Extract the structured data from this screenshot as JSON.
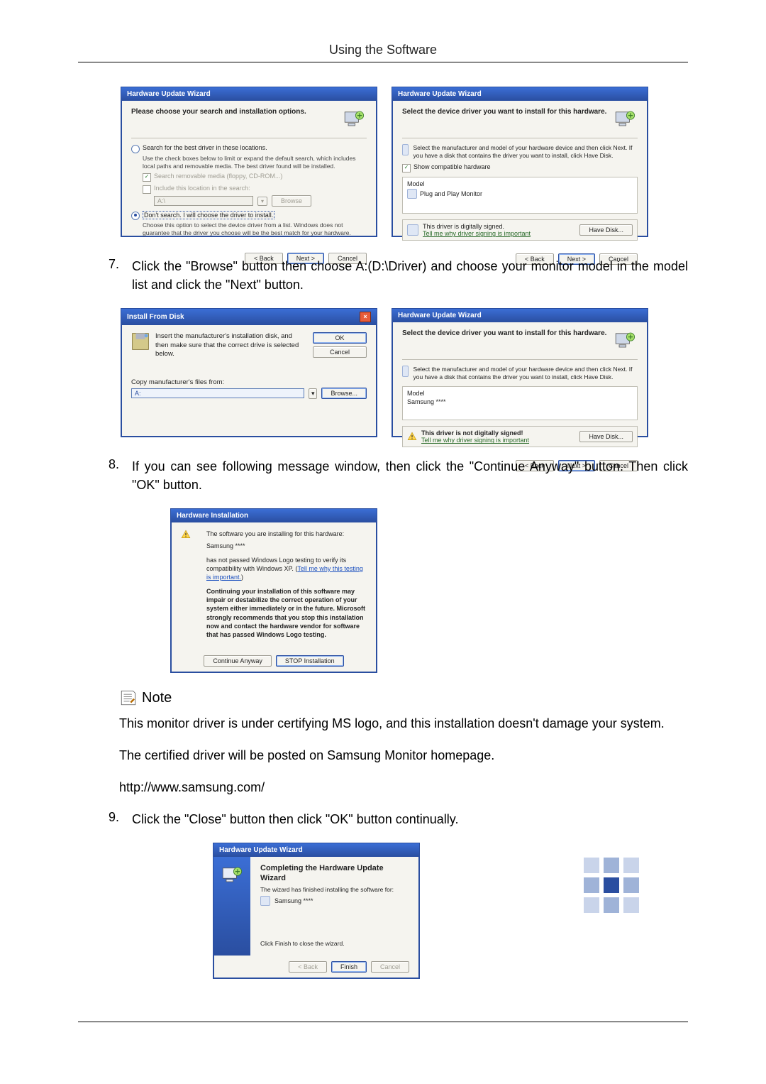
{
  "header": {
    "title": "Using the Software"
  },
  "dlg1": {
    "title": "Hardware Update Wizard",
    "headline": "Please choose your search and installation options.",
    "radio1": "Search for the best driver in these locations.",
    "radio1_sub": "Use the check boxes below to limit or expand the default search, which includes local paths and removable media. The best driver found will be installed.",
    "chk1": "Search removable media (floppy, CD-ROM...)",
    "chk2": "Include this location in the search:",
    "path_value": "A:\\",
    "browse_btn": "Browse",
    "radio2": "Don't search. I will choose the driver to install.",
    "radio2_sub": "Choose this option to select the device driver from a list. Windows does not guarantee that the driver you choose will be the best match for your hardware.",
    "back": "< Back",
    "next": "Next >",
    "cancel": "Cancel"
  },
  "dlg2": {
    "title": "Hardware Update Wizard",
    "headline": "Select the device driver you want to install for this hardware.",
    "instruction": "Select the manufacturer and model of your hardware device and then click Next. If you have a disk that contains the driver you want to install, click Have Disk.",
    "show_compat": "Show compatible hardware",
    "model_label": "Model",
    "model_item": "Plug and Play Monitor",
    "signed": "This driver is digitally signed.",
    "tell_me": "Tell me why driver signing is important",
    "have_disk": "Have Disk...",
    "back": "< Back",
    "next": "Next >",
    "cancel": "Cancel"
  },
  "step7": {
    "num": "7.",
    "text": "Click the \"Browse\" button then choose A:(D:\\Driver) and choose your monitor model in the model list and click the \"Next\" button."
  },
  "dlg3": {
    "title": "Install From Disk",
    "msg": "Insert the manufacturer's installation disk, and then make sure that the correct drive is selected below.",
    "ok": "OK",
    "cancel": "Cancel",
    "copy_label": "Copy manufacturer's files from:",
    "path": "A:",
    "browse": "Browse..."
  },
  "dlg4": {
    "title": "Hardware Update Wizard",
    "headline": "Select the device driver you want to install for this hardware.",
    "instruction": "Select the manufacturer and model of your hardware device and then click Next. If you have a disk that contains the driver you want to install, click Have Disk.",
    "model_label": "Model",
    "model_item": "Samsung ****",
    "signed": "This driver is not digitally signed!",
    "tell_me": "Tell me why driver signing is important",
    "have_disk": "Have Disk...",
    "back": "< Back",
    "next": "Next >",
    "cancel": "Cancel"
  },
  "step8": {
    "num": "8.",
    "text": "If you can see following message window, then click the \"Continue Anyway\" button. Then click \"OK\" button."
  },
  "dlg5": {
    "title": "Hardware Installation",
    "line1": "The software you are installing for this hardware:",
    "line2": "Samsung ****",
    "line3a": "has not passed Windows Logo testing to verify its compatibility with Windows XP. (",
    "line3b": "Tell me why this testing is important.",
    "line3c": ")",
    "bold": "Continuing your installation of this software may impair or destabilize the correct operation of your system either immediately or in the future. Microsoft strongly recommends that you stop this installation now and contact the hardware vendor for software that has passed Windows Logo testing.",
    "continue": "Continue Anyway",
    "stop": "STOP Installation"
  },
  "note": {
    "label": "Note",
    "p1": "This monitor driver is under certifying MS logo, and this installation doesn't damage your system.",
    "p2": "The certified driver will be posted on Samsung Monitor homepage.",
    "p3": "http://www.samsung.com/"
  },
  "step9": {
    "num": "9.",
    "text": "Click the \"Close\" button then click \"OK\" button continually."
  },
  "dlg6": {
    "title": "Hardware Update Wizard",
    "headline": "Completing the Hardware Update Wizard",
    "sub": "The wizard has finished installing the software for:",
    "item": "Samsung ****",
    "closing": "Click Finish to close the wizard.",
    "back": "< Back",
    "finish": "Finish",
    "cancel": "Cancel"
  }
}
